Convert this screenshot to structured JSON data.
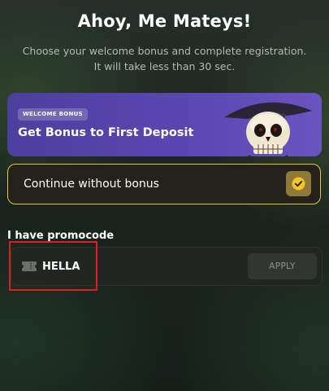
{
  "header": {
    "title": "Ahoy, Me Mateys!",
    "subtitle_line1": "Choose your welcome bonus and complete registration.",
    "subtitle_line2": "It will take less than 30 sec."
  },
  "bonus_card": {
    "badge": "WELCOME BONUS",
    "title": "Get Bonus to First Deposit",
    "image": "pirate-skull"
  },
  "no_bonus_option": {
    "label": "Continue without bonus",
    "selected": true,
    "icon": "check-icon"
  },
  "promocode": {
    "label": "I have promocode",
    "value": "HELLA",
    "icon": "ticket-icon",
    "apply_label": "APPLY"
  },
  "colors": {
    "accent_gold": "#e6c43c",
    "bonus_purple": "#5a46b0",
    "annotation_red": "#e11d1d"
  }
}
